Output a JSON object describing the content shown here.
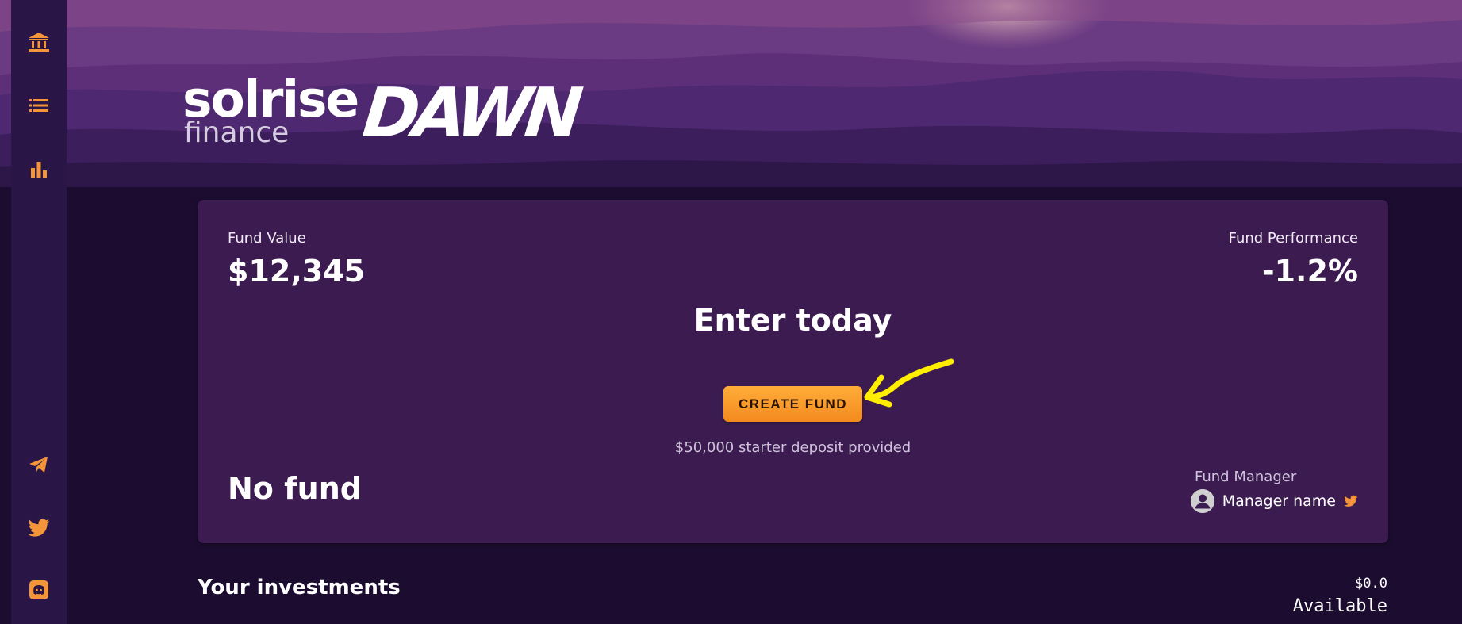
{
  "brand": {
    "name": "solrise",
    "sub": "finance",
    "product": "DAWN"
  },
  "sidebar": {
    "top_icons": [
      "bank-icon",
      "list-icon",
      "bar-chart-icon"
    ],
    "bottom_icons": [
      "telegram-icon",
      "twitter-icon",
      "discord-icon"
    ],
    "accent": "#f4953a"
  },
  "fund_card": {
    "fund_value_label": "Fund Value",
    "fund_value": "$12,345",
    "fund_performance_label": "Fund Performance",
    "fund_performance": "-1.2%",
    "headline": "Enter today",
    "cta_label": "CREATE FUND",
    "deposit_note": "$50,000 starter deposit provided",
    "fund_name": "No fund",
    "manager_label": "Fund Manager",
    "manager_name": "Manager name"
  },
  "investments": {
    "title": "Your investments",
    "available_amount": "$0.0",
    "available_label": "Available"
  },
  "colors": {
    "background": "#1c0d30",
    "card": "#3c1c50",
    "sidebar": "#2a1547",
    "button": "#f7952a",
    "annotation_arrow": "#ffff00"
  }
}
